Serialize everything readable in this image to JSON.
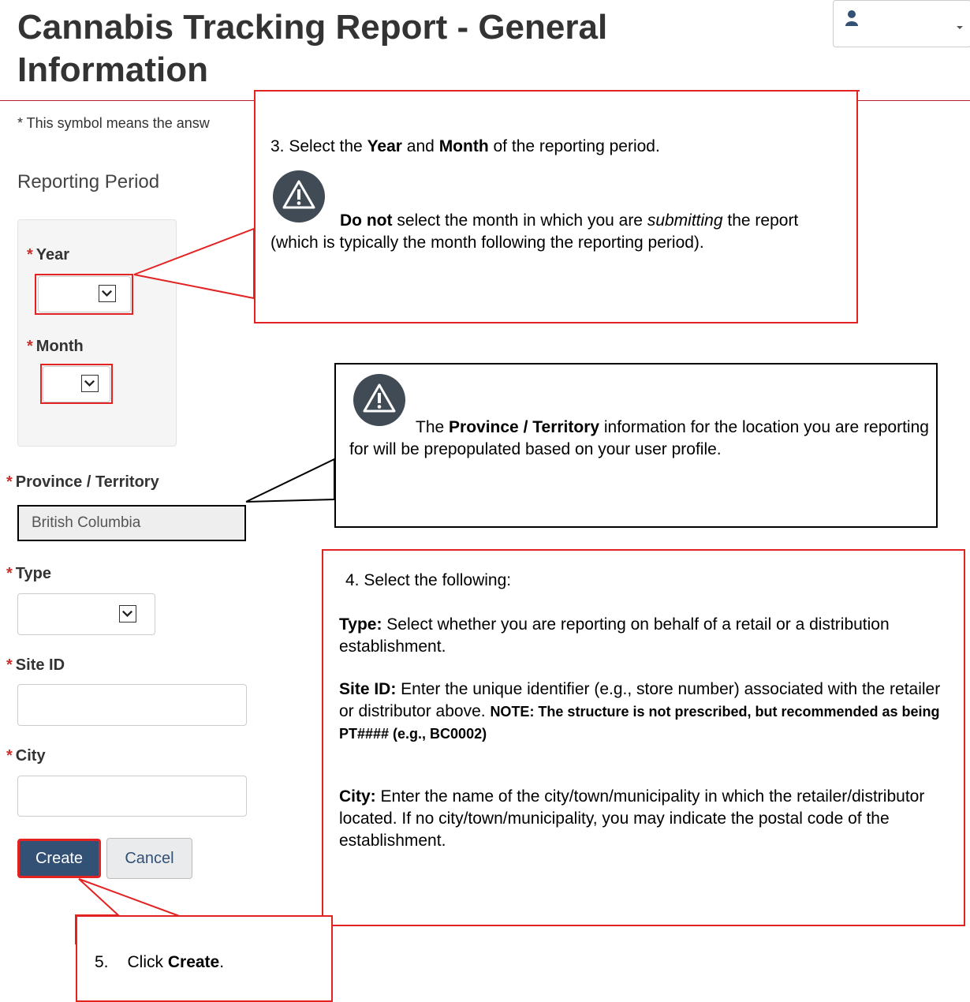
{
  "header": {
    "title": "Cannabis Tracking Report - General Information",
    "user_icon": "user-icon"
  },
  "required_note": "* This symbol means the answ",
  "reporting_period": {
    "legend": "Reporting Period",
    "year_label": "Year",
    "month_label": "Month"
  },
  "fields": {
    "province_label": "Province / Territory",
    "province_value": "British Columbia",
    "type_label": "Type",
    "site_id_label": "Site ID",
    "city_label": "City",
    "required_marker": "*"
  },
  "buttons": {
    "create": "Create",
    "cancel": "Cancel"
  },
  "callouts": {
    "step3": {
      "lead": "3. Select the ",
      "year": "Year",
      "and": " and ",
      "month": "Month",
      "tail": " of the reporting period.",
      "warn_bold": "Do not",
      "warn_a": " select the month in which you are ",
      "warn_em": "submitting",
      "warn_b": " the report (which is typically the month following the reporting period)."
    },
    "province": {
      "a": "The ",
      "bold": "Province / Territory",
      "b": " information for the location you are reporting for will be prepopulated based on your user profile."
    },
    "step4": {
      "heading": "4. Select the following:",
      "type_label": "Type:",
      "type_text": " Select whether you are reporting on behalf of a retail or a distribution establishment.",
      "site_label": "Site ID:",
      "site_text": " Enter the unique identifier (e.g., store number) associated with the retailer or distributor above. ",
      "note": "NOTE: The structure is not prescribed, but recommended as being PT#### (e.g., BC0002)",
      "city_label": "City:",
      "city_text": " Enter the name of the city/town/municipality in which the retailer/distributor located. If no city/town/municipality, you may indicate the postal code of the establishment."
    },
    "step5": {
      "number": "5.",
      "lead": "Click ",
      "bold": "Create",
      "end": "."
    }
  },
  "colors": {
    "accent_red": "#e32222",
    "title_rule": "#b41f2a",
    "primary_button": "#335075"
  }
}
